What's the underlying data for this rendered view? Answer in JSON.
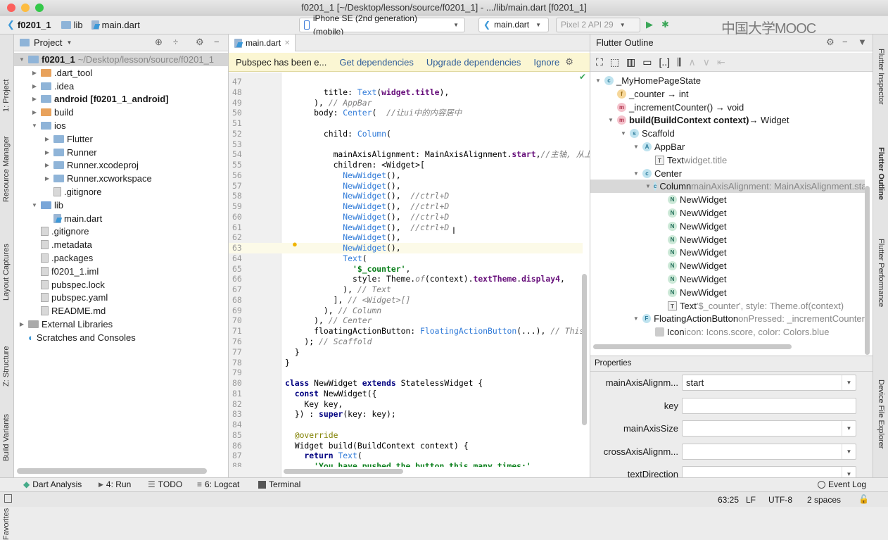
{
  "window": {
    "title": "f0201_1 [~/Desktop/lesson/source/f0201_1] - .../lib/main.dart [f0201_1]"
  },
  "watermark": "中国大学MOOC",
  "nav": {
    "breadcrumb": [
      "f0201_1",
      "lib",
      "main.dart"
    ],
    "device": "iPhone SE (2nd generation) (mobile)",
    "run_config": "main.dart",
    "emulator": "Pixel 2 API 29"
  },
  "left_strip": [
    "1: Project",
    "Resource Manager",
    "Layout Captures",
    "Z: Structure",
    "Build Variants",
    "Favorites"
  ],
  "right_strip": [
    "Flutter Inspector",
    "Flutter Outline",
    "Flutter Performance",
    "Device File Explorer"
  ],
  "project": {
    "header": "Project",
    "items": [
      {
        "label": "f0201_1",
        "extra": " ~/Desktop/lesson/source/f0201_1",
        "depth": 0,
        "arrow": "down",
        "icon": "folder",
        "bold": true,
        "selected": true
      },
      {
        "label": ".dart_tool",
        "depth": 1,
        "arrow": "right",
        "icon": "folder-orange"
      },
      {
        "label": ".idea",
        "depth": 1,
        "arrow": "right",
        "icon": "folder"
      },
      {
        "label": "android [f0201_1_android]",
        "depth": 1,
        "arrow": "right",
        "icon": "folder",
        "bold": true
      },
      {
        "label": "build",
        "depth": 1,
        "arrow": "right",
        "icon": "folder-orange"
      },
      {
        "label": "ios",
        "depth": 1,
        "arrow": "down",
        "icon": "folder"
      },
      {
        "label": "Flutter",
        "depth": 2,
        "arrow": "right",
        "icon": "folder"
      },
      {
        "label": "Runner",
        "depth": 2,
        "arrow": "right",
        "icon": "folder"
      },
      {
        "label": "Runner.xcodeproj",
        "depth": 2,
        "arrow": "right",
        "icon": "folder"
      },
      {
        "label": "Runner.xcworkspace",
        "depth": 2,
        "arrow": "right",
        "icon": "folder"
      },
      {
        "label": ".gitignore",
        "depth": 2,
        "arrow": "",
        "icon": "file"
      },
      {
        "label": "lib",
        "depth": 1,
        "arrow": "down",
        "icon": "folder-blue"
      },
      {
        "label": "main.dart",
        "depth": 2,
        "arrow": "",
        "icon": "dart"
      },
      {
        "label": ".gitignore",
        "depth": 1,
        "arrow": "",
        "icon": "file"
      },
      {
        "label": ".metadata",
        "depth": 1,
        "arrow": "",
        "icon": "file"
      },
      {
        "label": ".packages",
        "depth": 1,
        "arrow": "",
        "icon": "file"
      },
      {
        "label": "f0201_1.iml",
        "depth": 1,
        "arrow": "",
        "icon": "file"
      },
      {
        "label": "pubspec.lock",
        "depth": 1,
        "arrow": "",
        "icon": "file"
      },
      {
        "label": "pubspec.yaml",
        "depth": 1,
        "arrow": "",
        "icon": "file"
      },
      {
        "label": "README.md",
        "depth": 1,
        "arrow": "",
        "icon": "file"
      },
      {
        "label": "External Libraries",
        "depth": 0,
        "arrow": "right",
        "icon": "library"
      },
      {
        "label": "Scratches and Consoles",
        "depth": 0,
        "arrow": "",
        "icon": "scratch"
      }
    ]
  },
  "editor": {
    "tab": "main.dart",
    "notification": {
      "message": "Pubspec has been e...",
      "actions": [
        "Get dependencies",
        "Upgrade dependencies",
        "Ignore"
      ]
    },
    "current_line": 63,
    "lines": [
      {
        "n": "47",
        "t": []
      },
      {
        "n": "48",
        "t": [
          [
            "        title: ",
            "n"
          ],
          [
            "Text",
            "t"
          ],
          [
            "(",
            "n"
          ],
          [
            "widget.title",
            "p"
          ],
          [
            "),",
            "n"
          ]
        ]
      },
      {
        "n": "49",
        "t": [
          [
            "      ), ",
            "n"
          ],
          [
            "// AppBar",
            "c"
          ]
        ]
      },
      {
        "n": "50",
        "t": [
          [
            "      body: ",
            "n"
          ],
          [
            "Center",
            "t"
          ],
          [
            "(  ",
            "n"
          ],
          [
            "//让ui中的内容居中",
            "c"
          ]
        ]
      },
      {
        "n": "51",
        "t": []
      },
      {
        "n": "52",
        "t": [
          [
            "        child: ",
            "n"
          ],
          [
            "Column",
            "t"
          ],
          [
            "(",
            "n"
          ]
        ]
      },
      {
        "n": "53",
        "t": []
      },
      {
        "n": "54",
        "t": [
          [
            "          mainAxisAlignment: MainAxisAlignment.",
            "n"
          ],
          [
            "start",
            "p"
          ],
          [
            ",",
            "n"
          ],
          [
            "//主轴, 从上",
            "c"
          ]
        ]
      },
      {
        "n": "55",
        "t": [
          [
            "          children: <Widget>[",
            "n"
          ]
        ]
      },
      {
        "n": "56",
        "t": [
          [
            "            ",
            "n"
          ],
          [
            "NewWidget",
            "t"
          ],
          [
            "(),",
            "n"
          ]
        ]
      },
      {
        "n": "57",
        "t": [
          [
            "            ",
            "n"
          ],
          [
            "NewWidget",
            "t"
          ],
          [
            "(),",
            "n"
          ]
        ]
      },
      {
        "n": "58",
        "t": [
          [
            "            ",
            "n"
          ],
          [
            "NewWidget",
            "t"
          ],
          [
            "(),  ",
            "n"
          ],
          [
            "//ctrl+D",
            "c"
          ]
        ]
      },
      {
        "n": "59",
        "t": [
          [
            "            ",
            "n"
          ],
          [
            "NewWidget",
            "t"
          ],
          [
            "(),  ",
            "n"
          ],
          [
            "//ctrl+D",
            "c"
          ]
        ]
      },
      {
        "n": "60",
        "t": [
          [
            "            ",
            "n"
          ],
          [
            "NewWidget",
            "t"
          ],
          [
            "(),  ",
            "n"
          ],
          [
            "//ctrl+D",
            "c"
          ]
        ]
      },
      {
        "n": "61",
        "t": [
          [
            "            ",
            "n"
          ],
          [
            "NewWidget",
            "t"
          ],
          [
            "(),  ",
            "n"
          ],
          [
            "//ctrl+D",
            "c"
          ]
        ]
      },
      {
        "n": "62",
        "t": [
          [
            "            ",
            "n"
          ],
          [
            "NewWidget",
            "t"
          ],
          [
            "(),",
            "n"
          ]
        ]
      },
      {
        "n": "63",
        "t": [
          [
            "            ",
            "n"
          ],
          [
            "NewWidget",
            "t"
          ],
          [
            "(),",
            "n"
          ]
        ]
      },
      {
        "n": "64",
        "t": [
          [
            "            ",
            "n"
          ],
          [
            "Text",
            "t"
          ],
          [
            "(",
            "n"
          ]
        ]
      },
      {
        "n": "65",
        "t": [
          [
            "              ",
            "n"
          ],
          [
            "'$_counter'",
            "s"
          ],
          [
            ",",
            "n"
          ]
        ]
      },
      {
        "n": "66",
        "t": [
          [
            "              style: Theme.",
            "n"
          ],
          [
            "of",
            "c"
          ],
          [
            "(context).",
            "n"
          ],
          [
            "textTheme",
            "p"
          ],
          [
            ".",
            "n"
          ],
          [
            "display4",
            "p"
          ],
          [
            ",",
            "n"
          ]
        ]
      },
      {
        "n": "67",
        "t": [
          [
            "            ), ",
            "n"
          ],
          [
            "// Text",
            "c"
          ]
        ]
      },
      {
        "n": "68",
        "t": [
          [
            "          ], ",
            "n"
          ],
          [
            "// <Widget>[]",
            "c"
          ]
        ]
      },
      {
        "n": "69",
        "t": [
          [
            "        ), ",
            "n"
          ],
          [
            "// Column",
            "c"
          ]
        ]
      },
      {
        "n": "70",
        "t": [
          [
            "      ), ",
            "n"
          ],
          [
            "// Center",
            "c"
          ]
        ]
      },
      {
        "n": "71",
        "t": [
          [
            "      floatingActionButton: ",
            "n"
          ],
          [
            "FloatingActionButton",
            "t"
          ],
          [
            "(...), ",
            "n"
          ],
          [
            "// This",
            "c"
          ]
        ]
      },
      {
        "n": "76",
        "t": [
          [
            "    ); ",
            "n"
          ],
          [
            "// Scaffold",
            "c"
          ]
        ]
      },
      {
        "n": "77",
        "t": [
          [
            "  }",
            "n"
          ]
        ]
      },
      {
        "n": "78",
        "t": [
          [
            "}",
            "n"
          ]
        ]
      },
      {
        "n": "79",
        "t": []
      },
      {
        "n": "80",
        "t": [
          [
            "class ",
            "k"
          ],
          [
            "NewWidget ",
            "n"
          ],
          [
            "extends ",
            "k"
          ],
          [
            "StatelessWidget {",
            "n"
          ]
        ]
      },
      {
        "n": "81",
        "t": [
          [
            "  const ",
            "k"
          ],
          [
            "NewWidget({",
            "n"
          ]
        ]
      },
      {
        "n": "82",
        "t": [
          [
            "    Key key,",
            "n"
          ]
        ]
      },
      {
        "n": "83",
        "t": [
          [
            "  }) : ",
            "n"
          ],
          [
            "super",
            "k"
          ],
          [
            "(key: key);",
            "n"
          ]
        ]
      },
      {
        "n": "84",
        "t": []
      },
      {
        "n": "85",
        "t": [
          [
            "  @override",
            "a"
          ]
        ]
      },
      {
        "n": "86",
        "t": [
          [
            "  Widget build(BuildContext context) {",
            "n"
          ]
        ]
      },
      {
        "n": "87",
        "t": [
          [
            "    return ",
            "k"
          ],
          [
            "Text",
            "t"
          ],
          [
            "(",
            "n"
          ]
        ]
      },
      {
        "n": "88",
        "t": [
          [
            "      'You have pushed the button this many times:'",
            "s"
          ]
        ]
      }
    ]
  },
  "outline": {
    "header": "Flutter Outline",
    "items": [
      {
        "badge": "c",
        "label": "_MyHomePageState",
        "depth": 0,
        "arrow": "down"
      },
      {
        "badge": "f",
        "label": "_counter → int",
        "depth": 1
      },
      {
        "badge": "m",
        "label": "_incrementCounter() → void",
        "depth": 1
      },
      {
        "badge": "m",
        "label": "build(BuildContext context)",
        "suffix": " → Widget",
        "depth": 1,
        "arrow": "down",
        "bold": true
      },
      {
        "badge": "s",
        "label": "Scaffold",
        "depth": 2,
        "arrow": "down"
      },
      {
        "badge": "a",
        "label": "AppBar",
        "depth": 3,
        "arrow": "down"
      },
      {
        "badge": "t",
        "label": "Text",
        "hint": " widget.title",
        "depth": 4
      },
      {
        "badge": "c",
        "label": "Center",
        "depth": 3,
        "arrow": "down"
      },
      {
        "badge": "c",
        "label": "Column",
        "hint": " mainAxisAlignment: MainAxisAlignment.start",
        "depth": 4,
        "arrow": "down",
        "selected": true
      },
      {
        "badge": "n",
        "label": "NewWidget",
        "depth": 5
      },
      {
        "badge": "n",
        "label": "NewWidget",
        "depth": 5
      },
      {
        "badge": "n",
        "label": "NewWidget",
        "depth": 5
      },
      {
        "badge": "n",
        "label": "NewWidget",
        "depth": 5
      },
      {
        "badge": "n",
        "label": "NewWidget",
        "depth": 5
      },
      {
        "badge": "n",
        "label": "NewWidget",
        "depth": 5
      },
      {
        "badge": "n",
        "label": "NewWidget",
        "depth": 5
      },
      {
        "badge": "n",
        "label": "NewWidget",
        "depth": 5
      },
      {
        "badge": "t",
        "label": "Text",
        "hint": " '$_counter', style: Theme.of(context)",
        "depth": 5
      },
      {
        "badge": "f",
        "label": "FloatingActionButton",
        "hint": " onPressed: _incrementCounter",
        "depth": 3,
        "arrow": "down"
      },
      {
        "badge": "i",
        "label": "Icon",
        "hint": " icon: Icons.score, color: Colors.blue",
        "depth": 4
      }
    ]
  },
  "properties": {
    "header": "Properties",
    "rows": [
      {
        "label": "mainAxisAlignm...",
        "value": "start",
        "dropdown": true
      },
      {
        "label": "key",
        "value": "",
        "dropdown": false
      },
      {
        "label": "mainAxisSize",
        "value": "",
        "dropdown": true
      },
      {
        "label": "crossAxisAlignm...",
        "value": "",
        "dropdown": true
      },
      {
        "label": "textDirection",
        "value": "",
        "dropdown": true
      }
    ]
  },
  "bottom_tools": [
    "Dart Analysis",
    "4: Run",
    "TODO",
    "6: Logcat",
    "Terminal"
  ],
  "event_log": "Event Log",
  "status": {
    "position": "63:25",
    "line_sep": "LF",
    "encoding": "UTF-8",
    "indent": "2 spaces"
  },
  "colors": {
    "accent": "#2f7ad8",
    "selection": "#d5d5d5",
    "notification": "#fbf6d3"
  }
}
